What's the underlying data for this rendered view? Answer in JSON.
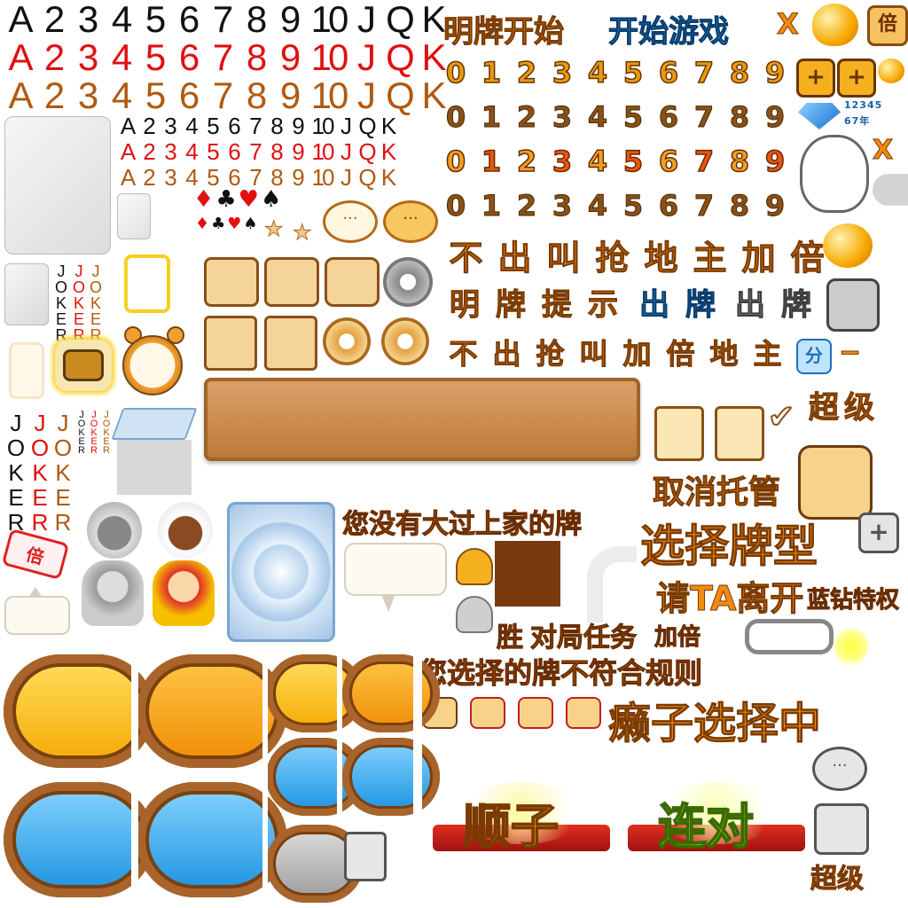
{
  "ranks": [
    "A",
    "2",
    "3",
    "4",
    "5",
    "6",
    "7",
    "8",
    "9",
    "10",
    "J",
    "Q",
    "K"
  ],
  "suits": {
    "diamond": "♦",
    "club": "♣",
    "heart": "♥",
    "spade": "♠"
  },
  "joker": "JOKER",
  "stamp_text": "倍",
  "buttons": {
    "show_cards_start": "明牌开始",
    "start_game": "开始游戏",
    "close_x": "X",
    "double_badge": "倍",
    "plus": "+",
    "minus": "−",
    "fen_badge": "分"
  },
  "gem_digits": "12345",
  "gem_digits2": "67年",
  "digits": [
    "0",
    "1",
    "2",
    "3",
    "4",
    "5",
    "6",
    "7",
    "8",
    "9"
  ],
  "action_row1": [
    "不",
    "出",
    "叫",
    "抢",
    "地",
    "主",
    "加",
    "倍"
  ],
  "action_row2_orange": [
    "明",
    "牌",
    "提",
    "示"
  ],
  "action_row2_blue": [
    "出",
    "牌"
  ],
  "action_row2_gray": [
    "出",
    "牌"
  ],
  "action_row3": [
    "不",
    "出",
    "抢",
    "叫",
    "加",
    "倍",
    "地",
    "主"
  ],
  "texts": {
    "super": "超级",
    "cancel_auto": "取消托管",
    "not_bigger": "您没有大过上家的牌",
    "choose_type": "选择牌型",
    "ask_leave": "请TA离开",
    "vip_privilege": "蓝钻特权",
    "win": "胜",
    "match_task": "对局任务",
    "add_double": "加倍",
    "invalid_cards": "您选择的牌不符合规则",
    "wild_choosing": "癞子选择中",
    "straight": "顺子",
    "pairs": "连对",
    "super_bottom": "超级"
  },
  "colors": {
    "orange": "#f28a10",
    "blue": "#1c90d8",
    "red": "#e01010",
    "brown": "#b05a10",
    "wood": "#c98a4a",
    "gold": "#f7c21a",
    "sky": "#3aa8ea",
    "gray": "#9a9a9a"
  },
  "icons": [
    "clipboard-icon",
    "check-icon",
    "robot-icon",
    "gear-icon",
    "exit-door-icon",
    "table-icon",
    "alarm-clock-icon",
    "chat-bubble-icon",
    "star-icon",
    "diamond-gem-icon",
    "ok-hand-icon",
    "link-chain-icon",
    "bean-icon",
    "hat-icon",
    "farmer-avatar-icon",
    "landlord-avatar-icon"
  ]
}
